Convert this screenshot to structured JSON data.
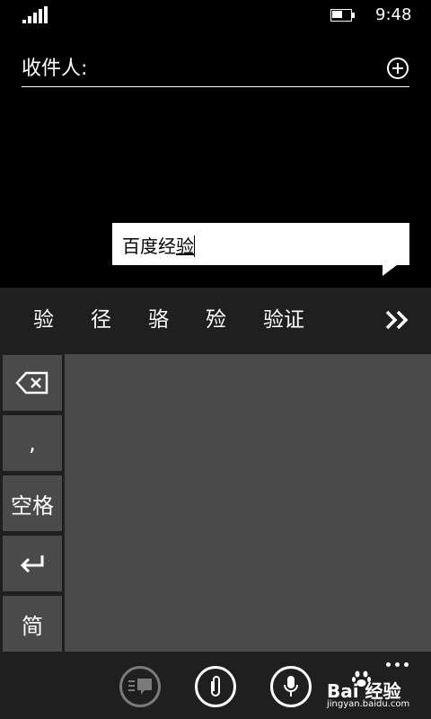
{
  "status_bar": {
    "time": "9:48",
    "battery_level": 0.6
  },
  "compose": {
    "recipient_label": "收件人:",
    "message_prefix": "百度经",
    "message_composing": "验"
  },
  "candidates": [
    "验",
    "径",
    "骆",
    "殓",
    "验证"
  ],
  "keyboard": {
    "comma_key": ",",
    "space_key": "空格",
    "mode_key": "简"
  },
  "watermark": {
    "brand": "Bai 经验",
    "url": "jingyan.baidu.com"
  },
  "colors": {
    "background": "#000000",
    "panel": "#1f1f1f",
    "key": "#4a4a4a",
    "text": "#ffffff"
  },
  "icons": [
    "signal-icon",
    "battery-icon",
    "add-recipient-icon",
    "expand-candidates-icon",
    "backspace-icon",
    "enter-icon",
    "switch-keyboard-icon",
    "attach-icon",
    "microphone-icon",
    "more-icon"
  ]
}
